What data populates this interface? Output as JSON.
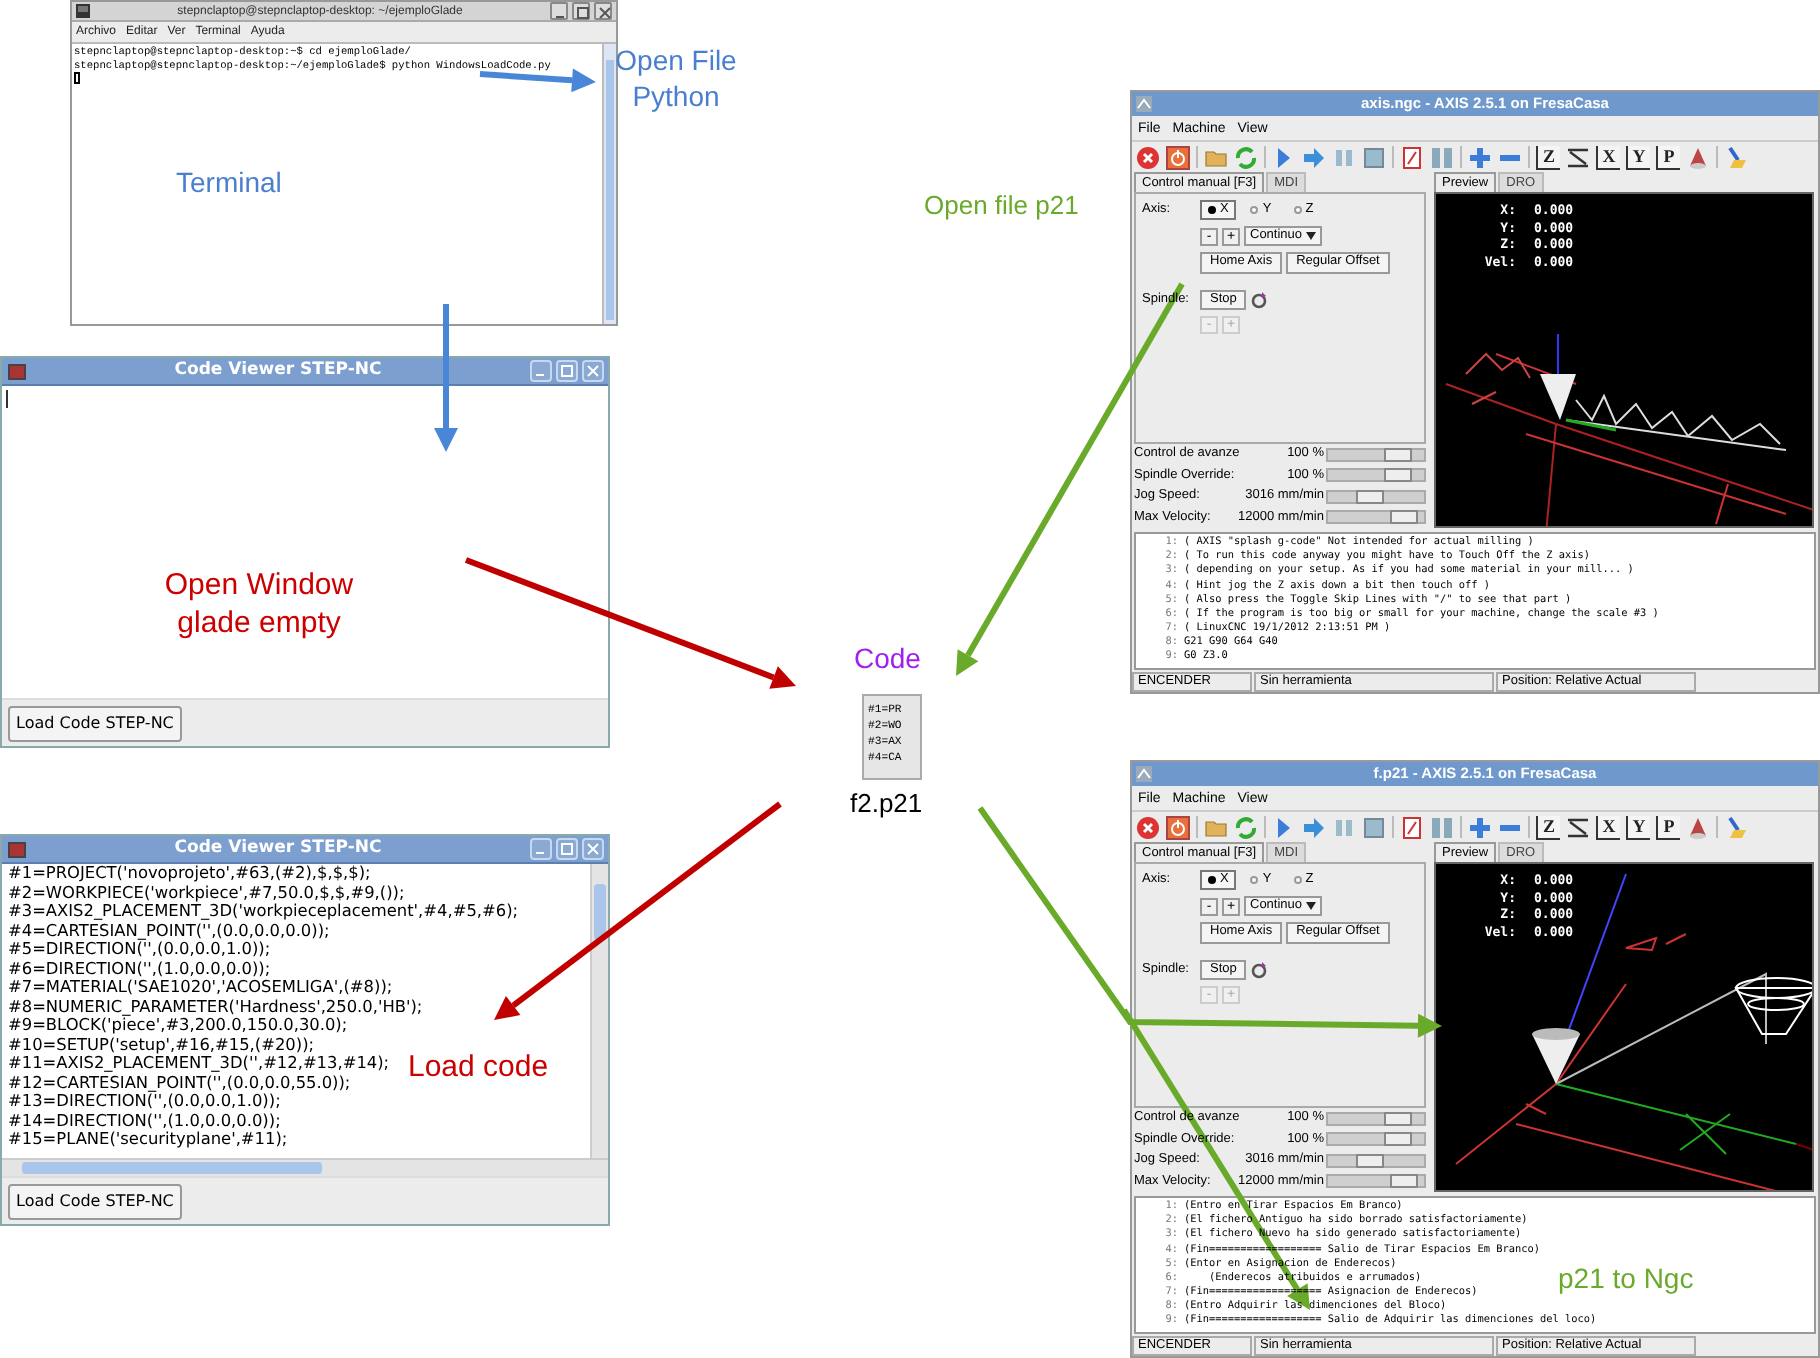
{
  "terminal": {
    "title": "stepnclaptop@stepnclaptop-desktop: ~/ejemploGlade",
    "menu": [
      "Archivo",
      "Editar",
      "Ver",
      "Terminal",
      "Ayuda"
    ],
    "lines": [
      "stepnclaptop@stepnclaptop-desktop:~$ cd ejemploGlade/",
      "stepnclaptop@stepnclaptop-desktop:~/ejemploGlade$ python WindowsLoadCode.py"
    ]
  },
  "code_viewers": [
    {
      "title": "Code Viewer STEP-NC",
      "button": "Load Code STEP-NC"
    },
    {
      "title": "Code Viewer STEP-NC",
      "button": "Load Code STEP-NC",
      "lines": [
        "#1=PROJECT('novoprojeto',#63,(#2),$,$,$);",
        "#2=WORKPIECE('workpiece',#7,50.0,$,$,#9,());",
        "#3=AXIS2_PLACEMENT_3D('workpieceplacement',#4,#5,#6);",
        "#4=CARTESIAN_POINT('',(0.0,0.0,0.0));",
        "#5=DIRECTION('',(0.0,0.0,1.0));",
        "#6=DIRECTION('',(1.0,0.0,0.0));",
        "#7=MATERIAL('SAE1020','ACOSEMLIGA',(#8));",
        "#8=NUMERIC_PARAMETER('Hardness',250.0,'HB');",
        "#9=BLOCK('piece',#3,200.0,150.0,30.0);",
        "#10=SETUP('setup',#16,#15,(#20));",
        "#11=AXIS2_PLACEMENT_3D('',#12,#13,#14);",
        "#12=CARTESIAN_POINT('',(0.0,0.0,55.0));",
        "#13=DIRECTION('',(0.0,0.0,1.0));",
        "#14=DIRECTION('',(1.0,0.0,0.0));",
        "#15=PLANE('securityplane',#11);"
      ]
    }
  ],
  "file_icon": {
    "lines": [
      "#1=PR",
      "#2=WO",
      "#3=AX",
      "#4=CA"
    ],
    "name": "f2.p21"
  },
  "annotations": [
    {
      "text": "Open File Python",
      "color": "#4a7fd0"
    },
    {
      "text": "Terminal",
      "color": "#4a7fd0"
    },
    {
      "text": "Open Window glade empty",
      "color": "#cc0000"
    },
    {
      "text": "Load code",
      "color": "#cc0000"
    },
    {
      "text": "Code",
      "color": "#a020f0"
    },
    {
      "text": "Open file p21",
      "color": "#6aaa2a"
    },
    {
      "text": "p21 to Ngc",
      "color": "#6aaa2a"
    }
  ],
  "axis_windows": [
    {
      "title": "axis.ngc - AXIS 2.5.1 on FresaCasa",
      "menu": [
        "File",
        "Machine",
        "View"
      ],
      "toolbar": [
        {
          "kind": "estop"
        },
        {
          "kind": "power"
        },
        {
          "kind": "open"
        },
        {
          "kind": "reload"
        },
        {
          "kind": "run"
        },
        {
          "kind": "step"
        },
        {
          "kind": "pause"
        },
        {
          "kind": "stop"
        },
        {
          "kind": "skip"
        },
        {
          "kind": "optional"
        },
        {
          "kind": "zoom_in"
        },
        {
          "kind": "zoom_out"
        },
        {
          "kind": "letter",
          "label": "Z"
        },
        {
          "kind": "rotated"
        },
        {
          "kind": "letter",
          "label": "X"
        },
        {
          "kind": "letter",
          "label": "Y"
        },
        {
          "kind": "letter",
          "label": "P"
        },
        {
          "kind": "perspective"
        },
        {
          "kind": "clear"
        }
      ],
      "control_tabs": [
        {
          "label": "Control manual [F3]",
          "selected": true
        },
        {
          "label": "MDI",
          "selected": false
        }
      ],
      "axis_label": "Axis:",
      "axes": [
        {
          "label": "X",
          "selected": true
        },
        {
          "label": "Y",
          "selected": false
        },
        {
          "label": "Z",
          "selected": false
        }
      ],
      "jog_buttons": [
        "-",
        "+"
      ],
      "jog_mode": "Continuo",
      "buttons": [
        "Home Axis",
        "Regular Offset"
      ],
      "spindle_label": "Spindle:",
      "spindle_button": "Stop",
      "spindle_jog": [
        "-",
        "+"
      ],
      "sliders": [
        {
          "label": "Control de avanze",
          "reading": "100 %",
          "level": 0.82
        },
        {
          "label": "Spindle Override:",
          "reading": "100 %",
          "level": 0.82
        },
        {
          "label": "Jog Speed:",
          "reading": "3016 mm/min",
          "level": 0.4
        },
        {
          "label": "Max Velocity:",
          "reading": "12000 mm/min",
          "level": 0.9
        }
      ],
      "view_tabs": [
        {
          "label": "Preview",
          "selected": true
        },
        {
          "label": "DRO",
          "selected": false
        }
      ],
      "dro": [
        {
          "axis": "X:",
          "value": "0.000"
        },
        {
          "axis": "Y:",
          "value": "0.000"
        },
        {
          "axis": "Z:",
          "value": "0.000"
        },
        {
          "axis": "Vel:",
          "value": "0.000"
        }
      ],
      "preview": {
        "kind": "splash"
      },
      "gcode": [
        {
          "number": "1:",
          "text": "( AXIS \"splash g-code\" Not intended for actual milling )"
        },
        {
          "number": "2:",
          "text": "( To run this code anyway you might have to Touch Off the Z axis)"
        },
        {
          "number": "3:",
          "text": "( depending on your setup. As if you had some material in your mill... )"
        },
        {
          "number": "4:",
          "text": "( Hint jog the Z axis down a bit then touch off )"
        },
        {
          "number": "5:",
          "text": "( Also press the Toggle Skip Lines with \"/\" to see that part )"
        },
        {
          "number": "6:",
          "text": "( If the program is too big or small for your machine, change the scale #3 )"
        },
        {
          "number": "7:",
          "text": "( LinuxCNC 19/1/2012 2:13:51 PM )"
        },
        {
          "number": "8:",
          "text": "G21 G90 G64 G40"
        },
        {
          "number": "9:",
          "text": "G0 Z3.0"
        }
      ],
      "status": [
        "ENCENDER",
        "Sin herramienta",
        "Position: Relative Actual"
      ]
    },
    {
      "title": "f.p21 - AXIS 2.5.1 on FresaCasa",
      "menu": [
        "File",
        "Machine",
        "View"
      ],
      "toolbar": [
        {
          "kind": "estop"
        },
        {
          "kind": "power"
        },
        {
          "kind": "open"
        },
        {
          "kind": "reload"
        },
        {
          "kind": "run"
        },
        {
          "kind": "step"
        },
        {
          "kind": "pause"
        },
        {
          "kind": "stop"
        },
        {
          "kind": "skip"
        },
        {
          "kind": "optional"
        },
        {
          "kind": "zoom_in"
        },
        {
          "kind": "zoom_out"
        },
        {
          "kind": "letter",
          "label": "Z"
        },
        {
          "kind": "rotated"
        },
        {
          "kind": "letter",
          "label": "X"
        },
        {
          "kind": "letter",
          "label": "Y"
        },
        {
          "kind": "letter",
          "label": "P"
        },
        {
          "kind": "perspective"
        },
        {
          "kind": "clear"
        }
      ],
      "control_tabs": [
        {
          "label": "Control manual [F3]",
          "selected": true
        },
        {
          "label": "MDI",
          "selected": false
        }
      ],
      "axis_label": "Axis:",
      "axes": [
        {
          "label": "X",
          "selected": true
        },
        {
          "label": "Y",
          "selected": false
        },
        {
          "label": "Z",
          "selected": false
        }
      ],
      "jog_buttons": [
        "-",
        "+"
      ],
      "jog_mode": "Continuo",
      "buttons": [
        "Home Axis",
        "Regular Offset"
      ],
      "spindle_label": "Spindle:",
      "spindle_button": "Stop",
      "spindle_jog": [
        "-",
        "+"
      ],
      "sliders": [
        {
          "label": "Control de avanze",
          "reading": "100 %",
          "level": 0.82
        },
        {
          "label": "Spindle Override:",
          "reading": "100 %",
          "level": 0.82
        },
        {
          "label": "Jog Speed:",
          "reading": "3016 mm/min",
          "level": 0.4
        },
        {
          "label": "Max Velocity:",
          "reading": "12000 mm/min",
          "level": 0.9
        }
      ],
      "view_tabs": [
        {
          "label": "Preview",
          "selected": true
        },
        {
          "label": "DRO",
          "selected": false
        }
      ],
      "dro": [
        {
          "axis": "X:",
          "value": "0.000"
        },
        {
          "axis": "Y:",
          "value": "0.000"
        },
        {
          "axis": "Z:",
          "value": "0.000"
        },
        {
          "axis": "Vel:",
          "value": "0.000"
        }
      ],
      "preview": {
        "kind": "part"
      },
      "gcode": [
        {
          "number": "1:",
          "text": "(Entro en Tirar Espacios Em Branco)"
        },
        {
          "number": "2:",
          "text": "(El fichero Antiguo ha sido borrado satisfactoriamente)"
        },
        {
          "number": "3:",
          "text": "(El fichero Nuevo ha sido generado satisfactoriamente)"
        },
        {
          "number": "4:",
          "text": "(Fin================== Salio de Tirar Espacios Em Branco)"
        },
        {
          "number": "5:",
          "text": "(Entor en Asignacion de Enderecos)"
        },
        {
          "number": "6:",
          "text": "    (Enderecos atribuidos e arrumados)"
        },
        {
          "number": "7:",
          "text": "(Fin================== Asignacion de Enderecos)"
        },
        {
          "number": "8:",
          "text": "(Entro Adquirir las dimenciones del Bloco)"
        },
        {
          "number": "9:",
          "text": "(Fin================== Salio de Adquirir las dimenciones del loco)"
        }
      ],
      "status": [
        "ENCENDER",
        "Sin herramienta",
        "Position: Relative Actual"
      ]
    }
  ]
}
